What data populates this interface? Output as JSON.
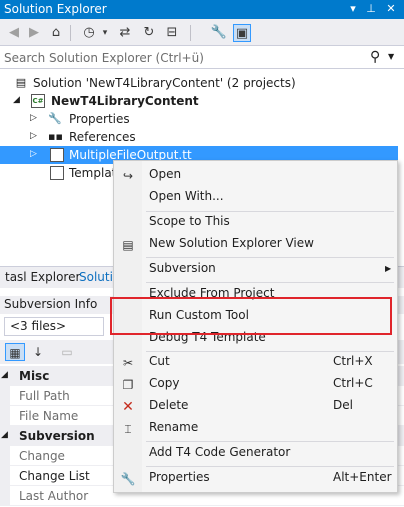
{
  "window": {
    "title": "Solution Explorer"
  },
  "search": {
    "placeholder": "Search Solution Explorer (Ctrl+ü)"
  },
  "toolbar_icons": [
    "back-arrow-icon",
    "forward-arrow-icon",
    "home-icon",
    "history-icon",
    "sync-icon",
    "refresh-icon",
    "collapse-icon",
    "properties-wrench-icon",
    "preview-icon"
  ],
  "tree": {
    "solution": "Solution 'NewT4LibraryContent' (2 projects)",
    "project": "NewT4LibraryContent",
    "properties": "Properties",
    "references": "References",
    "selected_file": "MultipleFileOutput.tt",
    "template": "Templat"
  },
  "tabs": {
    "tab1": "tasl Explorer",
    "tab2": "Solutio"
  },
  "svn": {
    "title": "Subversion Info",
    "files_selected": "<3 files>",
    "rows": [
      {
        "name": "Misc",
        "category": true
      },
      {
        "name": "Full Path",
        "category": false,
        "dim": true
      },
      {
        "name": "File Name",
        "category": false,
        "dim": true
      },
      {
        "name": "Subversion",
        "category": true
      },
      {
        "name": "Change",
        "category": false,
        "dim": true
      },
      {
        "name": "Change List",
        "category": false,
        "dim": false
      },
      {
        "name": "Last Author",
        "category": false,
        "dim": true
      }
    ]
  },
  "context_menu": {
    "open": "Open",
    "open_with": "Open With...",
    "scope": "Scope to This",
    "new_view": "New Solution Explorer View",
    "subversion": "Subversion",
    "exclude": "Exclude From Project",
    "run_tool": "Run Custom Tool",
    "debug_t4": "Debug T4 Template",
    "cut": "Cut",
    "cut_sc": "Ctrl+X",
    "copy": "Copy",
    "copy_sc": "Ctrl+C",
    "delete": "Delete",
    "delete_sc": "Del",
    "rename": "Rename",
    "add_t4": "Add T4 Code Generator",
    "properties": "Properties",
    "properties_sc": "Alt+Enter"
  },
  "colors": {
    "accent": "#007acc",
    "selection": "#3399ff",
    "highlight_border": "#e0252b"
  }
}
